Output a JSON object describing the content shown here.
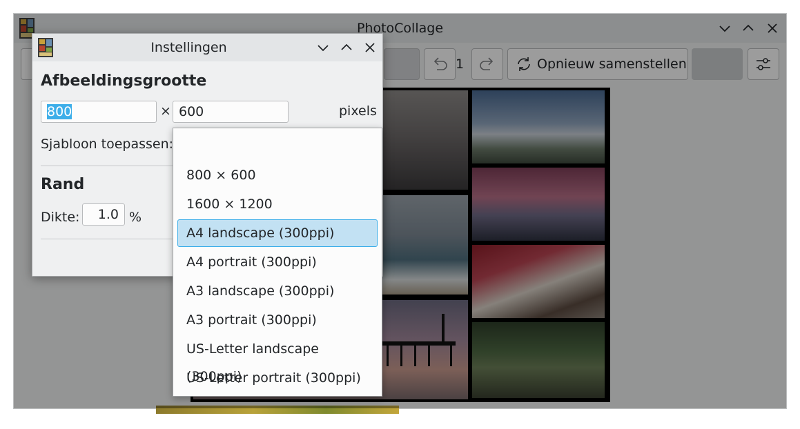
{
  "main_window": {
    "title": "PhotoCollage",
    "page_number": "1",
    "regenerate_label": "Opnieuw samenstellen"
  },
  "dialog": {
    "title": "Instellingen",
    "image_size_heading": "Afbeeldingsgrootte",
    "width_value": "800",
    "times_symbol": "×",
    "height_value": "600",
    "unit_label": "pixels",
    "template_label": "Sjabloon toepassen:",
    "border_heading": "Rand",
    "thickness_label": "Dikte:",
    "thickness_value": "1.0",
    "percent_label": "%"
  },
  "template_dropdown": {
    "options": [
      "",
      "800 × 600",
      "1600 × 1200",
      "A4 landscape (300ppi)",
      "A4 portrait (300ppi)",
      "A3 landscape (300ppi)",
      "A3 portrait (300ppi)",
      "US-Letter landscape (300ppi)",
      "US-Letter portrait (300ppi)"
    ],
    "highlighted": "A4 landscape (300ppi)"
  },
  "icons": {
    "minimize": "chevron-down-icon",
    "maximize": "chevron-up-icon",
    "close": "close-icon",
    "undo": "undo-icon",
    "redo": "redo-icon",
    "regenerate": "refresh-icon",
    "settings": "sliders-icon"
  },
  "colors": {
    "accent": "#3daee9",
    "highlight_bg": "#c2e1f3",
    "window_bg": "#eff0f1",
    "selection": "#3daee9"
  }
}
